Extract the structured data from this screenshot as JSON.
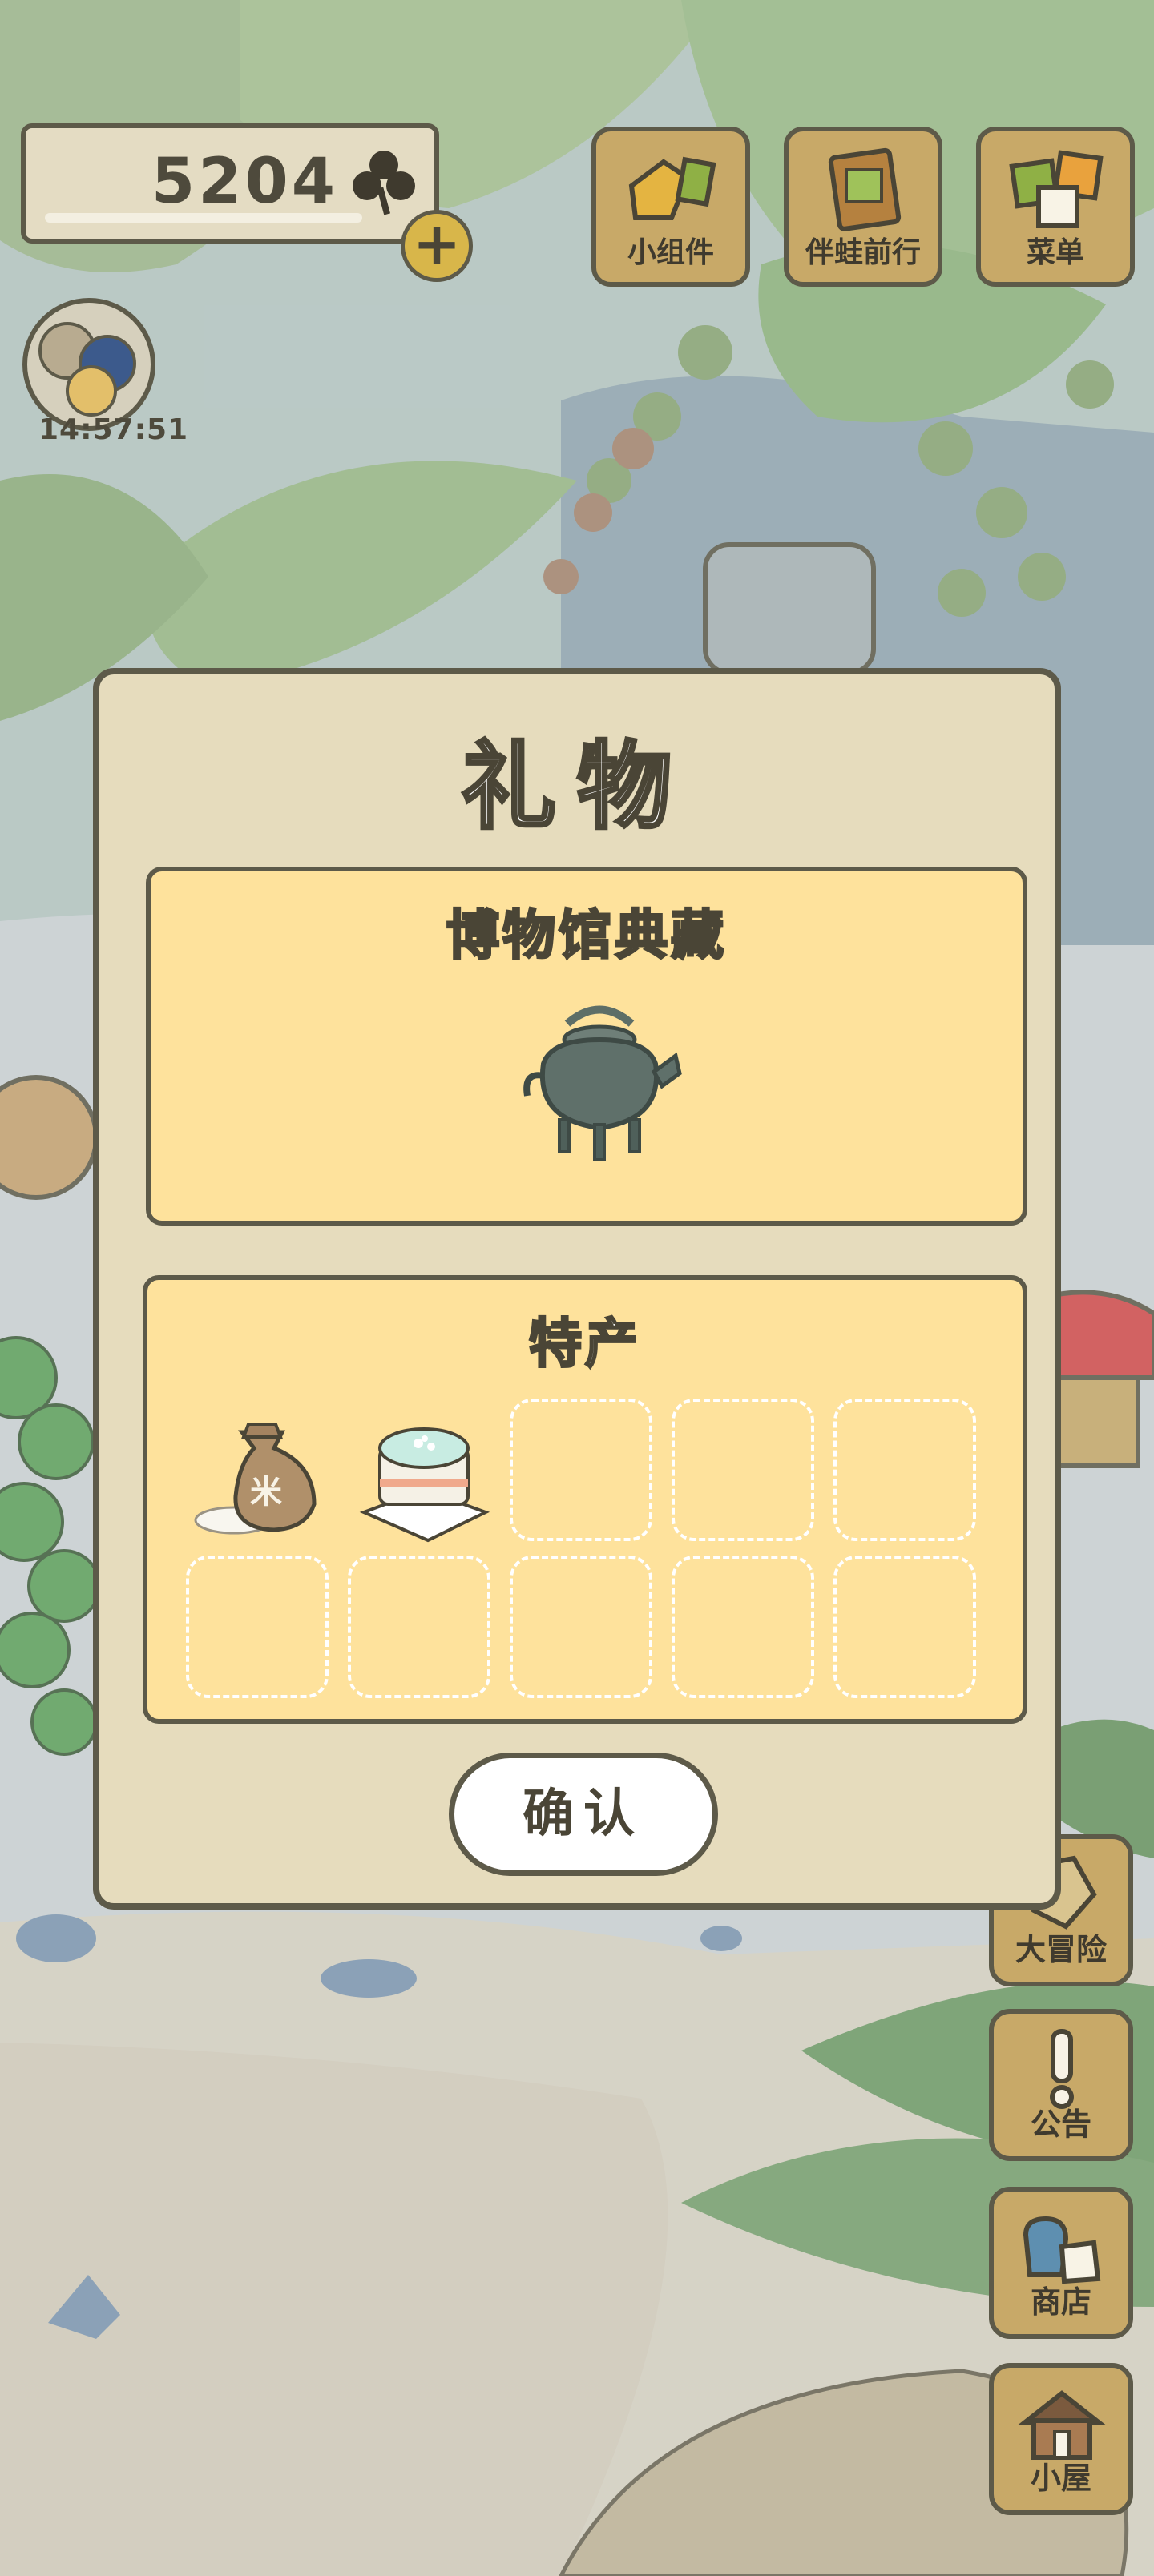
{
  "currency": {
    "clover_count": "5204",
    "icon": "clover-icon",
    "add_icon": "plus-icon"
  },
  "timer": {
    "value": "14:57:51"
  },
  "top_buttons": [
    {
      "label": "小组件",
      "icon": "widget-icon"
    },
    {
      "label": "伴蛙前行",
      "icon": "journey-book-icon"
    },
    {
      "label": "菜单",
      "icon": "menu-cards-icon"
    }
  ],
  "side_buttons": [
    {
      "label": "大冒险",
      "icon": "adventure-icon"
    },
    {
      "label": "公告",
      "icon": "exclamation-icon"
    },
    {
      "label": "商店",
      "icon": "shop-bags-icon"
    },
    {
      "label": "小屋",
      "icon": "house-icon"
    }
  ],
  "modal": {
    "title": "礼物",
    "museum": {
      "title": "博物馆典藏",
      "item_icon": "bronze-kettle-icon"
    },
    "specialty": {
      "title": "特产",
      "items": [
        {
          "icon": "rice-sack-icon",
          "text": "米"
        },
        {
          "icon": "cake-icon"
        }
      ],
      "empty_slots": 8
    },
    "confirm_label": "确认"
  },
  "colors": {
    "panel": "#fee29c",
    "modal": "#e6dcbd",
    "outline": "#5d5a49",
    "button_wood": "#c8a968"
  }
}
